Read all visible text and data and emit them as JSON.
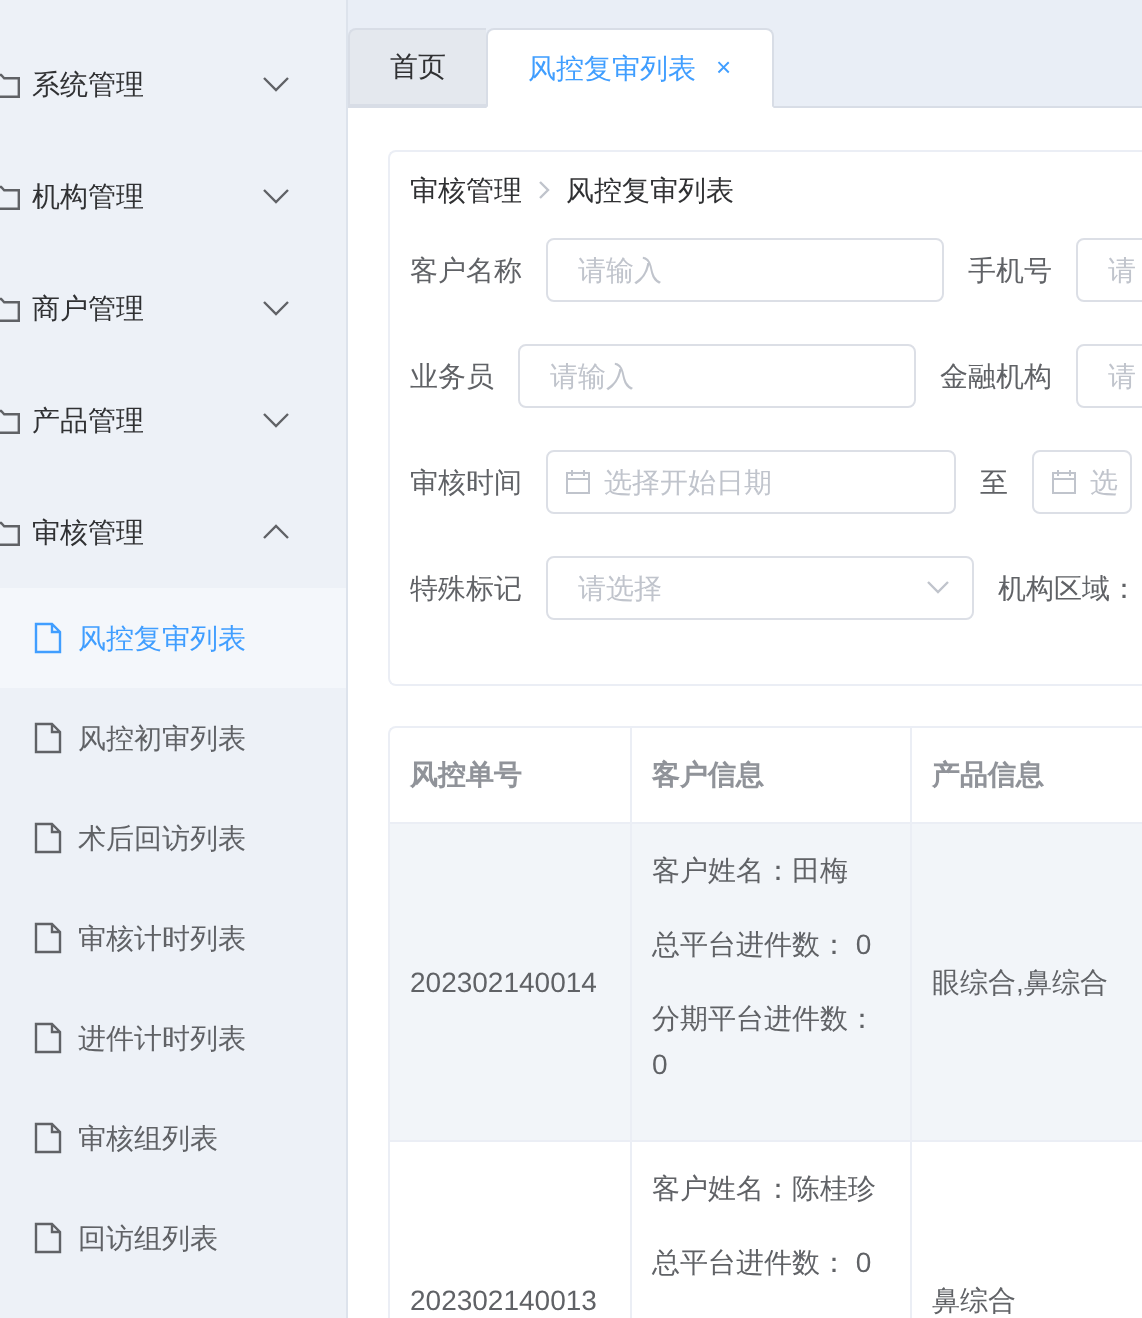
{
  "sidebar": {
    "groups": [
      {
        "label": "系统管理",
        "expanded": false
      },
      {
        "label": "机构管理",
        "expanded": false
      },
      {
        "label": "商户管理",
        "expanded": false
      },
      {
        "label": "产品管理",
        "expanded": false
      },
      {
        "label": "审核管理",
        "expanded": true,
        "children": [
          {
            "label": "风控复审列表",
            "selected": true
          },
          {
            "label": "风控初审列表",
            "selected": false
          },
          {
            "label": "术后回访列表",
            "selected": false
          },
          {
            "label": "审核计时列表",
            "selected": false
          },
          {
            "label": "进件计时列表",
            "selected": false
          },
          {
            "label": "审核组列表",
            "selected": false
          },
          {
            "label": "回访组列表",
            "selected": false
          }
        ]
      }
    ]
  },
  "tabs": [
    {
      "label": "首页",
      "selected": false,
      "closable": false
    },
    {
      "label": "风控复审列表",
      "selected": true,
      "closable": true,
      "close": "×"
    }
  ],
  "breadcrumb": [
    "审核管理",
    "风控复审列表"
  ],
  "filter_rows": [
    [
      {
        "label": "客户名称",
        "field": {
          "kind": "text",
          "placeholder": "请输入"
        }
      },
      {
        "label": "手机号",
        "field": {
          "kind": "text",
          "placeholder": "请"
        }
      }
    ],
    [
      {
        "label": "业务员",
        "field": {
          "kind": "text",
          "placeholder": "请输入"
        }
      },
      {
        "label": "金融机构",
        "field": {
          "kind": "text",
          "placeholder": "请"
        }
      }
    ],
    [
      {
        "label": "审核时间",
        "field": {
          "kind": "date",
          "placeholder": "选择开始日期"
        }
      },
      {
        "label": "至",
        "field": {
          "kind": "date",
          "placeholder": "选"
        }
      }
    ],
    [
      {
        "label": "特殊标记",
        "field": {
          "kind": "select",
          "placeholder": "请选择"
        }
      },
      {
        "label": "机构区域："
      }
    ]
  ],
  "table": {
    "columns": [
      "风控单号",
      "客户信息",
      "产品信息"
    ],
    "rows": [
      {
        "highlighted": true,
        "order_no": "202302140014",
        "customer_info": [
          "客户姓名：田梅",
          "总平台进件数： 0",
          "分期平台进件数： 0"
        ],
        "product": "眼综合,鼻综合"
      },
      {
        "highlighted": false,
        "order_no": "202302140013",
        "customer_info": [
          "客户姓名：陈桂珍",
          "总平台进件数： 0"
        ],
        "product": "鼻综合"
      }
    ]
  }
}
